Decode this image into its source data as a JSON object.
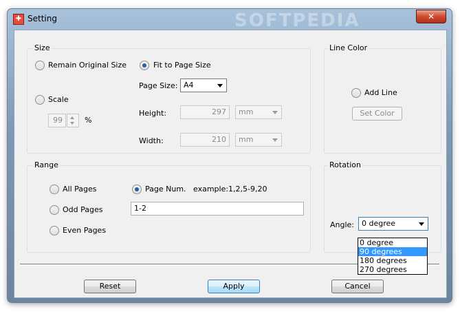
{
  "window": {
    "title": "Setting",
    "close_label": "✕",
    "watermark": "SOFTPEDIA"
  },
  "size": {
    "title": "Size",
    "remain_original": "Remain Original Size",
    "fit_to_page": "Fit to Page Size",
    "scale": "Scale",
    "scale_value": "99",
    "percent": "%",
    "page_size_label": "Page Size:",
    "page_size_value": "A4",
    "height_label": "Height:",
    "height_value": "297",
    "height_unit": "mm",
    "width_label": "Width:",
    "width_value": "210",
    "width_unit": "mm",
    "selected": "fit_to_page"
  },
  "line_color": {
    "title": "Line Color",
    "add_line": "Add Line",
    "set_color": "Set Color"
  },
  "range": {
    "title": "Range",
    "all_pages": "All Pages",
    "odd_pages": "Odd Pages",
    "even_pages": "Even Pages",
    "page_num": "Page Num.",
    "example": "example:1,2,5-9,20",
    "page_num_value": "1-2",
    "selected": "page_num"
  },
  "rotation": {
    "title": "Rotation",
    "angle_label": "Angle:",
    "angle_value": "0 degree",
    "options": [
      "0 degree",
      "90 degrees",
      "180 degrees",
      "270 degrees"
    ],
    "highlighted": "90 degrees"
  },
  "buttons": {
    "reset": "Reset",
    "apply": "Apply",
    "cancel": "Cancel"
  }
}
